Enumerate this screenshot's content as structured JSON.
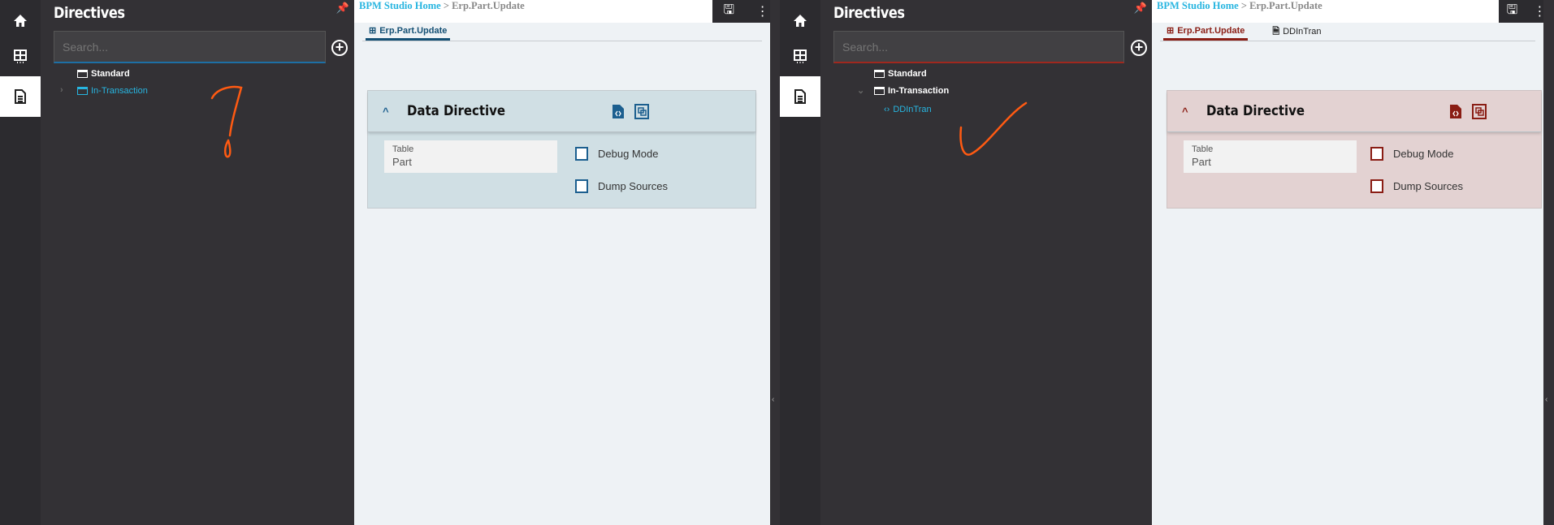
{
  "panes": [
    {
      "rail": {
        "items": [
          "home-icon",
          "grid-icon",
          "document-icon"
        ],
        "active": 2
      },
      "sidebar": {
        "title": "Directives",
        "search_placeholder": "Search...",
        "tree": [
          {
            "label": "Standard",
            "icon": "folder",
            "selected": false
          },
          {
            "label": "In-Transaction",
            "icon": "folder",
            "selected": true,
            "expanded": false
          }
        ]
      },
      "breadcrumb": {
        "home": "BPM Studio Home",
        "sep": ">",
        "current": "Erp.Part.Update"
      },
      "tabs": [
        {
          "label": "Erp.Part.Update",
          "active": true
        }
      ],
      "panel": {
        "title": "Data Directive",
        "field_label": "Table",
        "field_value": "Part",
        "checkboxes": [
          {
            "label": "Debug Mode",
            "checked": false
          },
          {
            "label": "Dump Sources",
            "checked": false
          }
        ]
      },
      "accent": "#1c5f8f",
      "annotation": "question-mark"
    },
    {
      "rail": {
        "items": [
          "home-icon",
          "grid-icon",
          "document-icon"
        ],
        "active": 2
      },
      "sidebar": {
        "title": "Directives",
        "search_placeholder": "Search...",
        "tree": [
          {
            "label": "Standard",
            "icon": "folder",
            "selected": false
          },
          {
            "label": "In-Transaction",
            "icon": "folder",
            "selected": false,
            "expanded": true
          },
          {
            "label": "DDInTran",
            "icon": "code",
            "selected": true
          }
        ]
      },
      "breadcrumb": {
        "home": "BPM Studio Home",
        "sep": ">",
        "current": "Erp.Part.Update"
      },
      "tabs": [
        {
          "label": "Erp.Part.Update",
          "active": true
        },
        {
          "label": "DDInTran",
          "active": false
        }
      ],
      "panel": {
        "title": "Data Directive",
        "field_label": "Table",
        "field_value": "Part",
        "checkboxes": [
          {
            "label": "Debug Mode",
            "checked": false
          },
          {
            "label": "Dump Sources",
            "checked": false
          }
        ]
      },
      "accent": "#8a1d14",
      "annotation": "check-mark"
    }
  ]
}
